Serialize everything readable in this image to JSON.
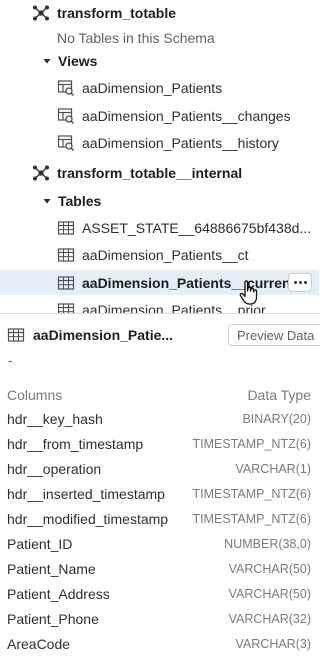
{
  "tree": {
    "schema1": {
      "name": "transform_totable",
      "empty_msg": "No Tables in this Schema"
    },
    "views_label": "Views",
    "views": [
      "aaDimension_Patients",
      "aaDimension_Patients__changes",
      "aaDimension_Patients__history"
    ],
    "schema2": {
      "name": "transform_totable__internal"
    },
    "tables_label": "Tables",
    "tables": [
      "ASSET_STATE__64886675bf438d...",
      "aaDimension_Patients__ct",
      "aaDimension_Patients__current",
      "aaDimension_Patients__prior"
    ]
  },
  "detail": {
    "title": "aaDimension_Patie...",
    "preview_label": "Preview Data",
    "description": "-",
    "columns_header": "Columns",
    "type_header": "Data Type",
    "columns": [
      {
        "name": "hdr__key_hash",
        "type": "BINARY(20)"
      },
      {
        "name": "hdr__from_timestamp",
        "type": "TIMESTAMP_NTZ(6)"
      },
      {
        "name": "hdr__operation",
        "type": "VARCHAR(1)"
      },
      {
        "name": "hdr__inserted_timestamp",
        "type": "TIMESTAMP_NTZ(6)"
      },
      {
        "name": "hdr__modified_timestamp",
        "type": "TIMESTAMP_NTZ(6)"
      },
      {
        "name": "Patient_ID",
        "type": "NUMBER(38,0)"
      },
      {
        "name": "Patient_Name",
        "type": "VARCHAR(50)"
      },
      {
        "name": "Patient_Address",
        "type": "VARCHAR(50)"
      },
      {
        "name": "Patient_Phone",
        "type": "VARCHAR(32)"
      },
      {
        "name": "AreaCode",
        "type": "VARCHAR(3)"
      }
    ]
  },
  "icons": {
    "schema": "schema-icon",
    "view": "view-icon",
    "table": "table-icon",
    "caret": "caret-down-icon",
    "more": "more-icon"
  },
  "colors": {
    "selected_bg": "#e3eef9",
    "muted": "#767b82",
    "text": "#2b2f33"
  }
}
